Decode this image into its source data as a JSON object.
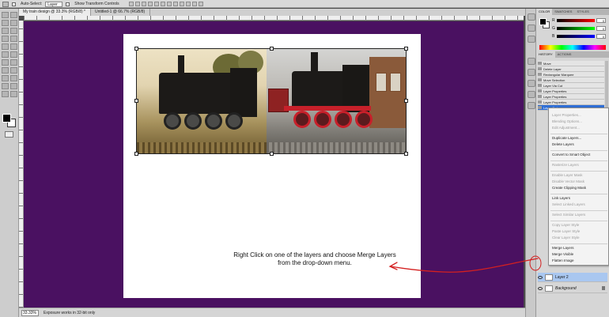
{
  "options_bar": {
    "auto_select_label": "Auto-Select:",
    "auto_select_value": "Layer",
    "transform_controls_label": "Show Transform Controls"
  },
  "document_tabs": [
    {
      "label": "My train design @ 33.3% (RGB/8) *"
    },
    {
      "label": "Untitled-1 @ 66.7% (RGB/8)"
    }
  ],
  "canvas": {
    "background": "#4a1161",
    "instruction_line1": "Right Click on one of the layers and choose Merge Layers",
    "instruction_line2": "from the drop-down menu."
  },
  "status_bar": {
    "zoom": "33.33%",
    "message": "Exposure works in 32-bit only"
  },
  "color_panel": {
    "tabs": [
      "COLOR",
      "SWATCHES",
      "STYLES"
    ],
    "sliders": [
      {
        "channel": "R",
        "value": "0"
      },
      {
        "channel": "G",
        "value": "0"
      },
      {
        "channel": "B",
        "value": "0"
      }
    ]
  },
  "history_panel": {
    "tabs": [
      "HISTORY",
      "ACTIONS"
    ],
    "items": [
      {
        "label": "Move"
      },
      {
        "label": "Delete Layer"
      },
      {
        "label": "Rectangular Marquee"
      },
      {
        "label": "Move Selection"
      },
      {
        "label": "Layer Via Cut"
      },
      {
        "label": "Layer Properties"
      },
      {
        "label": "Layer Properties"
      },
      {
        "label": "Layer Properties"
      },
      {
        "label": "Layer Order"
      }
    ],
    "selected_index": 8
  },
  "context_menu": {
    "items": [
      {
        "label": "Layer Properties...",
        "enabled": false
      },
      {
        "label": "Blending Options...",
        "enabled": false
      },
      {
        "label": "Edit Adjustment...",
        "enabled": false
      },
      {
        "label": "Duplicate Layers...",
        "enabled": true
      },
      {
        "label": "Delete Layers",
        "enabled": true
      },
      {
        "label": "Convert to Smart Object",
        "enabled": true
      },
      {
        "label": "Rasterize Layers",
        "enabled": false
      },
      {
        "label": "Enable Layer Mask",
        "enabled": false
      },
      {
        "label": "Disable Vector Mask",
        "enabled": false
      },
      {
        "label": "Create Clipping Mask",
        "enabled": true
      },
      {
        "label": "Link Layers",
        "enabled": true
      },
      {
        "label": "Select Linked Layers",
        "enabled": false
      },
      {
        "label": "Select Similar Layers",
        "enabled": false
      },
      {
        "label": "Copy Layer Style",
        "enabled": false
      },
      {
        "label": "Paste Layer Style",
        "enabled": false
      },
      {
        "label": "Clear Layer Style",
        "enabled": false
      },
      {
        "label": "Merge Layers",
        "enabled": true
      },
      {
        "label": "Merge Visible",
        "enabled": true
      },
      {
        "label": "Flatten Image",
        "enabled": true
      }
    ]
  },
  "layers_panel": {
    "layers": [
      {
        "name": "Layer 2",
        "selected": true
      },
      {
        "name": "Background",
        "selected": false
      }
    ]
  },
  "annotation_color": "#d42020"
}
